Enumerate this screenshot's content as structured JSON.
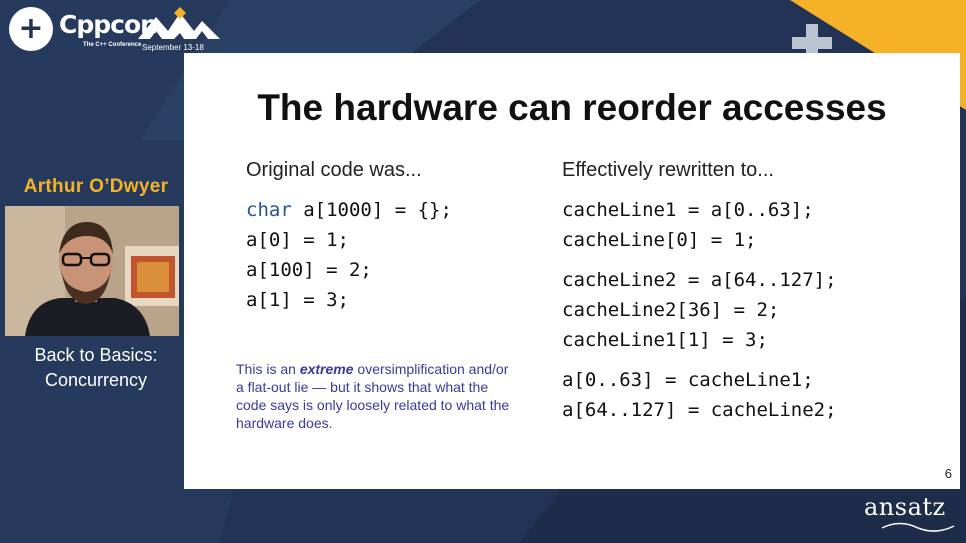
{
  "header": {
    "logo_mark": "+",
    "logo_text": "Cppcon",
    "logo_subtitle": "The C++ Conference",
    "event_dates": "September 13-18"
  },
  "speaker": {
    "name": "Arthur O’Dwyer"
  },
  "talk": {
    "title_line1": "Back to Basics:",
    "title_line2": "Concurrency"
  },
  "slide": {
    "title": "The hardware can reorder accesses",
    "left_heading": "Original code was...",
    "right_heading": "Effectively rewritten to...",
    "left_code": [
      {
        "keyword": "char",
        "rest": " a[1000] = {};"
      },
      {
        "keyword": "",
        "rest": "a[0] = 1;"
      },
      {
        "keyword": "",
        "rest": "a[100] = 2;"
      },
      {
        "keyword": "",
        "rest": "a[1] = 3;"
      }
    ],
    "right_code": [
      [
        "cacheLine1 = a[0..63];",
        "cacheLine[0] = 1;"
      ],
      [
        "cacheLine2 = a[64..127];",
        "cacheLine2[36] = 2;",
        "cacheLine1[1] = 3;"
      ],
      [
        "a[0..63] = cacheLine1;",
        "a[64..127] = cacheLine2;"
      ]
    ],
    "note": {
      "before": "This is an ",
      "emphasis": "extreme",
      "after": " oversimplification and/or a flat-out lie — but it shows that what the code says is only loosely related to what the hardware does."
    },
    "page_number": "6"
  },
  "branding": {
    "ansatz": "ansatz"
  },
  "colors": {
    "background": "#223355",
    "accent_yellow": "#f5b229",
    "note_text": "#3a3a9a",
    "code_keyword": "#2a5295"
  }
}
